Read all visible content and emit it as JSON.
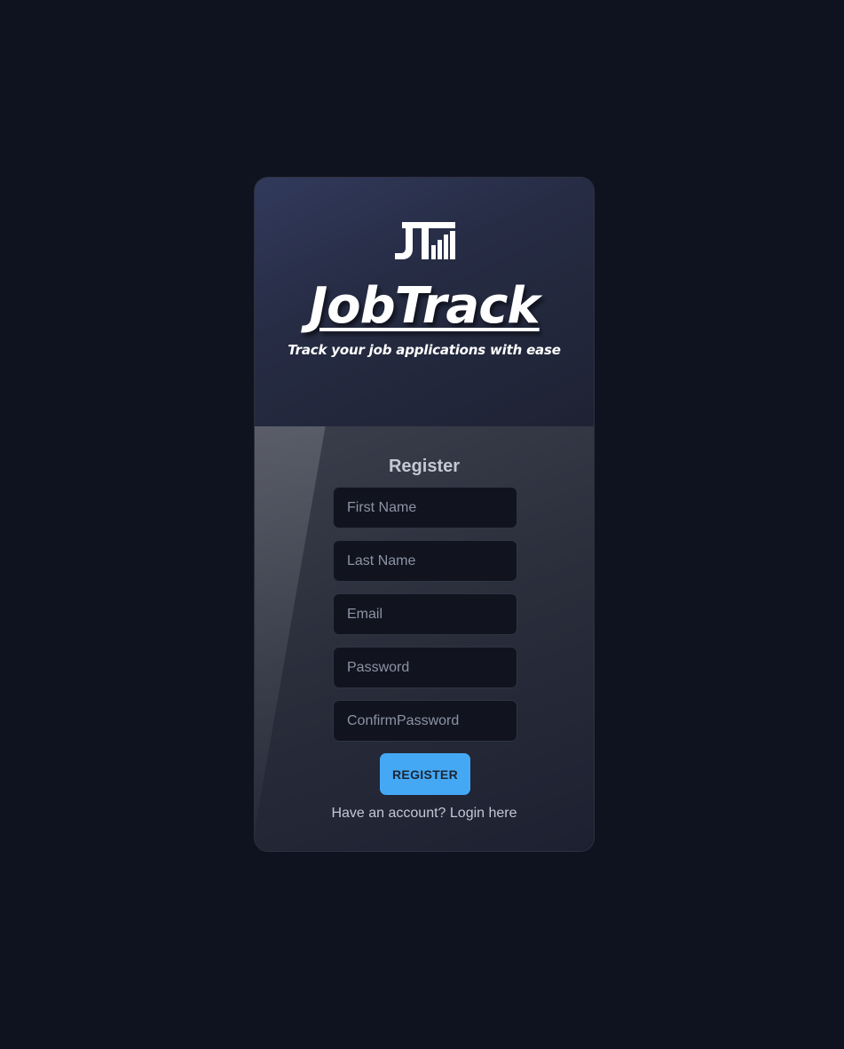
{
  "brand": {
    "logo_icon": "jt-bar-chart-logo-icon",
    "name": "JobTrack",
    "tagline": "Track your job applications with ease"
  },
  "form": {
    "title": "Register",
    "fields": {
      "first_name": {
        "placeholder": "First Name",
        "value": ""
      },
      "last_name": {
        "placeholder": "Last Name",
        "value": ""
      },
      "email": {
        "placeholder": "Email",
        "value": ""
      },
      "password": {
        "placeholder": "Password",
        "value": ""
      },
      "confirm_password": {
        "placeholder": "ConfirmPassword",
        "value": ""
      }
    },
    "submit_label": "REGISTER",
    "login_prompt": "Have an account?",
    "login_link": "Login here"
  },
  "colors": {
    "background": "#0f121f",
    "accent": "#45a8f5",
    "text_muted": "#c4c8d4"
  }
}
